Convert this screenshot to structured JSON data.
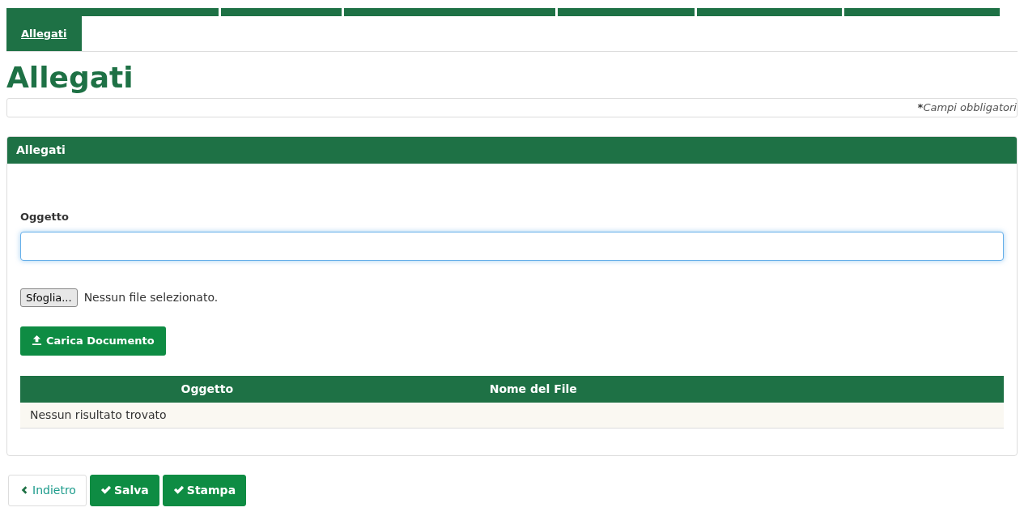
{
  "tabs": [
    {
      "label": "Allegati",
      "selected": true
    }
  ],
  "title": "Allegati",
  "required_note": {
    "mark": "*",
    "text": "Campi obbligatori"
  },
  "panel": {
    "title": "Allegati",
    "field": {
      "label": "Oggetto"
    },
    "file_input": {
      "button": "Sfoglia...",
      "status": "Nessun file selezionato."
    },
    "upload_button": "Carica Documento",
    "table": {
      "columns": [
        "Oggetto",
        "Nome del File"
      ],
      "empty_message": "Nessun risultato trovato"
    }
  },
  "buttons": [
    {
      "kind": "back",
      "label": "Indietro"
    },
    {
      "kind": "primary",
      "label": "Salva"
    },
    {
      "kind": "primary",
      "label": "Stampa"
    }
  ]
}
